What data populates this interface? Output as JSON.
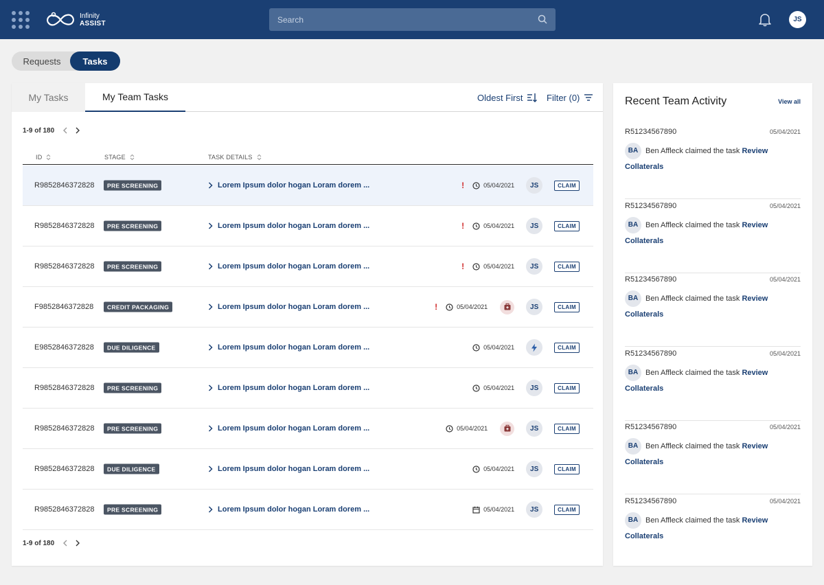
{
  "header": {
    "logo_line1": "Infinity",
    "logo_line2": "ASSIST",
    "search_placeholder": "Search",
    "user_initials": "JS",
    "brand_color": "#1a3f73"
  },
  "toggle": {
    "options": [
      "Requests",
      "Tasks"
    ],
    "selected": "Tasks"
  },
  "tabs": {
    "my_tasks": "My Tasks",
    "team_tasks": "My Team Tasks",
    "active": "My Team Tasks"
  },
  "controls": {
    "sort_label": "Oldest First",
    "filter_label": "Filter (0)"
  },
  "pagination": {
    "label": "1-9 of 180"
  },
  "table": {
    "columns": [
      "ID",
      "STAGE",
      "TASK DETAILS"
    ],
    "claim_label": "CLAIM",
    "rows": [
      {
        "id": "R9852846372828",
        "stage": "PRE SCREENING",
        "details": "Lorem Ipsum dolor hogan Loram dorem ...",
        "alert": true,
        "date": "05/04/2021",
        "date_icon": "clock-icon",
        "extra_icon": "",
        "assignee": "JS",
        "selected": true
      },
      {
        "id": "R9852846372828",
        "stage": "PRE SCREENING",
        "details": "Lorem Ipsum dolor hogan Loram dorem ...",
        "alert": true,
        "date": "05/04/2021",
        "date_icon": "clock-icon",
        "extra_icon": "",
        "assignee": "JS",
        "selected": false
      },
      {
        "id": "R9852846372828",
        "stage": "PRE SCREENING",
        "details": "Lorem Ipsum dolor hogan Loram dorem ...",
        "alert": true,
        "date": "05/04/2021",
        "date_icon": "clock-icon",
        "extra_icon": "",
        "assignee": "JS",
        "selected": false
      },
      {
        "id": "F9852846372828",
        "stage": "CREDIT PACKAGING",
        "details": "Lorem Ipsum dolor hogan Loram dorem ...",
        "alert": true,
        "date": "05/04/2021",
        "date_icon": "clock-icon",
        "extra_icon": "case-icon",
        "assignee": "JS",
        "selected": false
      },
      {
        "id": "E9852846372828",
        "stage": "DUE DILIGENCE",
        "details": "Lorem Ipsum dolor hogan Loram dorem ...",
        "alert": false,
        "date": "05/04/2021",
        "date_icon": "clock-icon",
        "extra_icon": "",
        "assignee": "lightning-icon",
        "selected": false
      },
      {
        "id": "R9852846372828",
        "stage": "PRE SCREENING",
        "details": "Lorem Ipsum dolor hogan Loram dorem ...",
        "alert": false,
        "date": "05/04/2021",
        "date_icon": "clock-icon",
        "extra_icon": "",
        "assignee": "JS",
        "selected": false
      },
      {
        "id": "R9852846372828",
        "stage": "PRE SCREENING",
        "details": "Lorem Ipsum dolor hogan Loram dorem ...",
        "alert": false,
        "date": "05/04/2021",
        "date_icon": "clock-icon",
        "extra_icon": "case-icon",
        "assignee": "JS",
        "selected": false
      },
      {
        "id": "R9852846372828",
        "stage": "DUE DILIGENCE",
        "details": "Lorem Ipsum dolor hogan Loram dorem ...",
        "alert": false,
        "date": "05/04/2021",
        "date_icon": "clock-icon",
        "extra_icon": "",
        "assignee": "JS",
        "selected": false
      },
      {
        "id": "R9852846372828",
        "stage": "PRE SCREENING",
        "details": "Lorem Ipsum dolor hogan Loram dorem ...",
        "alert": false,
        "date": "05/04/2021",
        "date_icon": "calendar-icon",
        "extra_icon": "",
        "assignee": "JS",
        "selected": false
      }
    ]
  },
  "activity": {
    "title": "Recent Team Activity",
    "view_all": "View all",
    "items": [
      {
        "id": "R51234567890",
        "date": "05/04/2021",
        "initials": "BA",
        "text": "Ben Affleck claimed the task",
        "link": "Review Collaterals"
      },
      {
        "id": "R51234567890",
        "date": "05/04/2021",
        "initials": "BA",
        "text": "Ben Affleck claimed the task",
        "link": "Review Collaterals"
      },
      {
        "id": "R51234567890",
        "date": "05/04/2021",
        "initials": "BA",
        "text": "Ben Affleck claimed the task",
        "link": "Review Collaterals"
      },
      {
        "id": "R51234567890",
        "date": "05/04/2021",
        "initials": "BA",
        "text": "Ben Affleck claimed the task",
        "link": "Review Collaterals"
      },
      {
        "id": "R51234567890",
        "date": "05/04/2021",
        "initials": "BA",
        "text": "Ben Affleck claimed the task",
        "link": "Review Collaterals"
      },
      {
        "id": "R51234567890",
        "date": "05/04/2021",
        "initials": "BA",
        "text": "Ben Affleck claimed the task",
        "link": "Review Collaterals"
      }
    ]
  }
}
